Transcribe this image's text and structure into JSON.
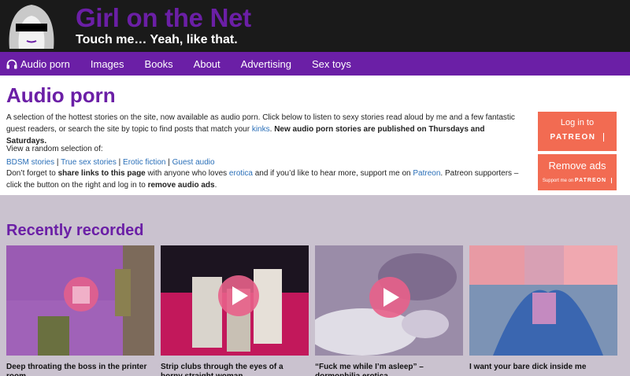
{
  "header": {
    "site_title": "Girl on the Net",
    "tagline": "Touch me… Yeah, like that."
  },
  "nav": {
    "items": [
      {
        "label": "Audio porn",
        "icon": "headphones-icon"
      },
      {
        "label": "Images"
      },
      {
        "label": "Books"
      },
      {
        "label": "About"
      },
      {
        "label": "Advertising"
      },
      {
        "label": "Sex toys"
      }
    ]
  },
  "intro": {
    "title": "Audio porn",
    "desc_part1": "A selection of the hottest stories on the site, now available as audio porn. Click below to listen to sexy stories read aloud by me and a few fantastic guest readers, or search the site by topic to find posts that match your ",
    "desc_link": "kinks",
    "desc_part2": ". ",
    "desc_bold": "New audio porn stories are published on Thursdays and Saturdays.",
    "view_random": "View a random selection of:",
    "links": [
      "BDSM stories",
      "True sex stories",
      "Erotic fiction",
      "Guest audio"
    ],
    "link_sep": " | ",
    "share_p1": "Don’t forget to ",
    "share_b1": "share links to this page",
    "share_p2": " with anyone who loves ",
    "share_l1": "erotica",
    "share_p3": " and if you’d like to hear more, support me on ",
    "share_l2": "Patreon",
    "share_p4": ". Patreon supporters – click the button on the right and log in to ",
    "share_b2": "remove audio ads",
    "share_p5": "."
  },
  "patreon": {
    "login_text": "Log in to",
    "login_brand": "PATREON",
    "remove_text": "Remove ads",
    "remove_sub": "Support me on",
    "remove_brand": "PATREON"
  },
  "recent": {
    "title": "Recently recorded",
    "cards": [
      {
        "title": "Deep throating the boss in the printer room"
      },
      {
        "title": "Strip clubs through the eyes of a horny straight woman"
      },
      {
        "title": "“Fuck me while I’m asleep” – dormophilia erotica"
      },
      {
        "title": "I want your bare dick inside me"
      }
    ]
  },
  "colors": {
    "brand_purple": "#6b1fa6",
    "header_black": "#1a1a1a",
    "patreon_coral": "#f26b52",
    "section_grey": "#cac2cf"
  }
}
